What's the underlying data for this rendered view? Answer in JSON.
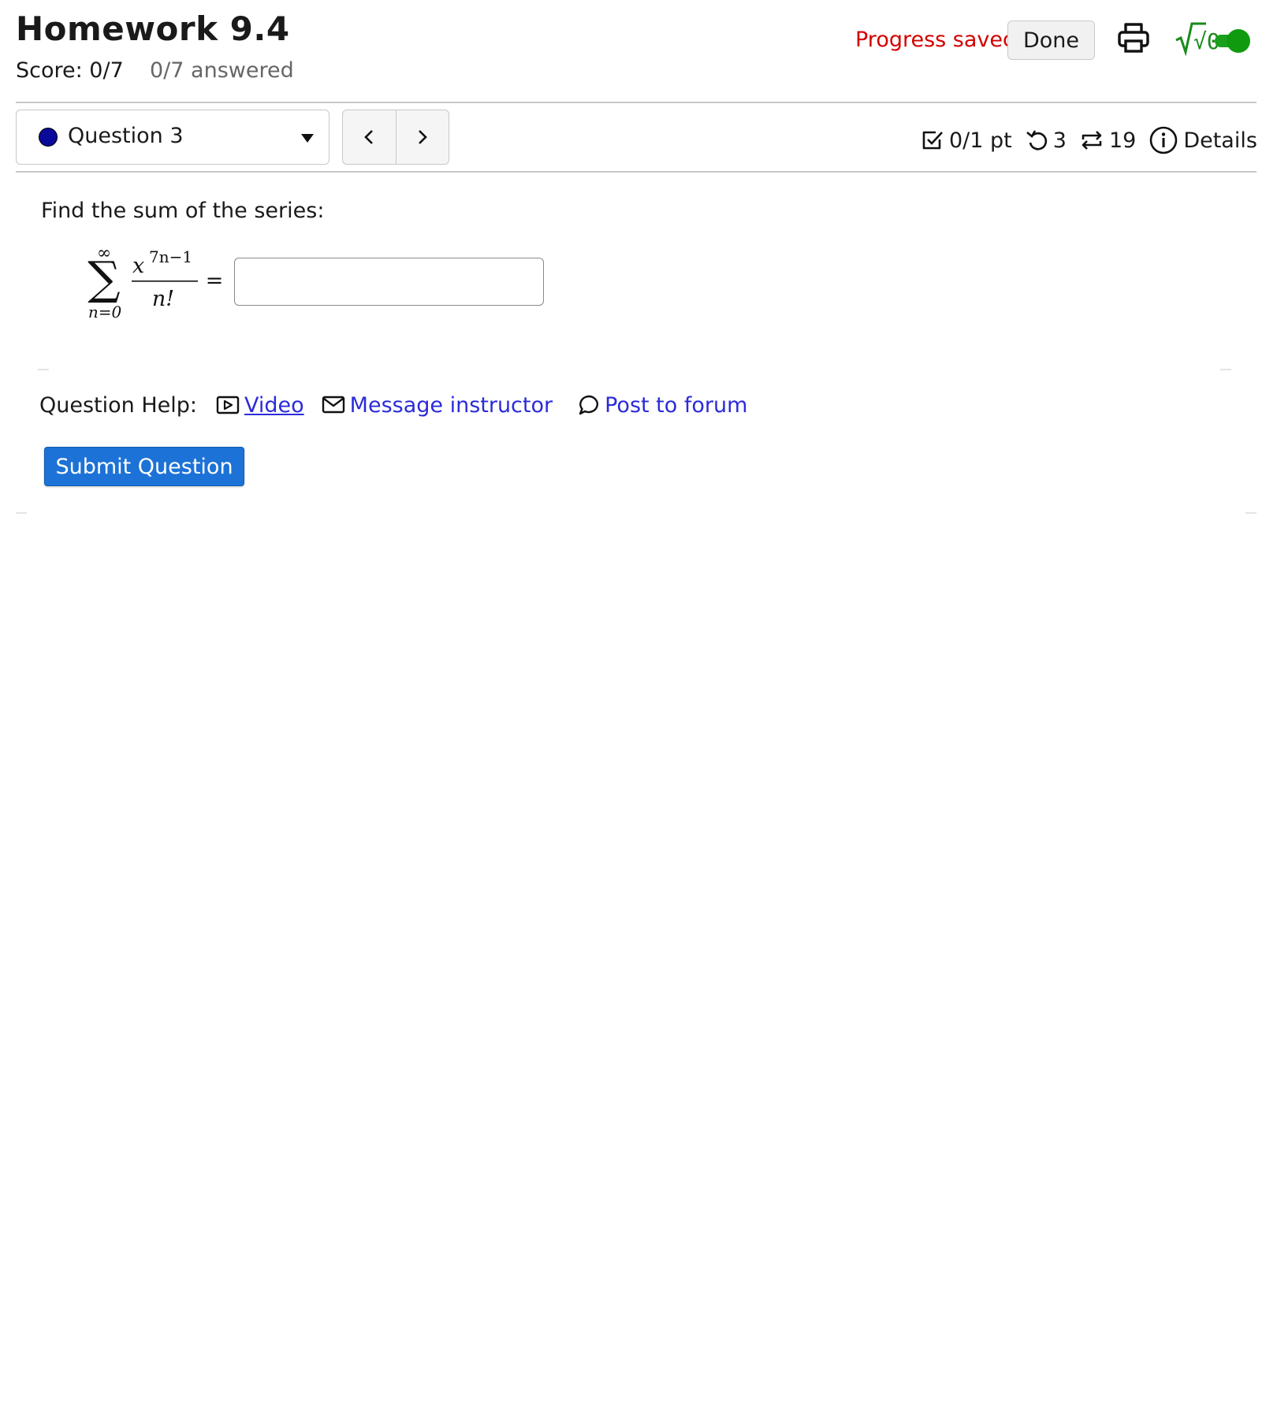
{
  "header": {
    "title": "Homework 9.4",
    "score": "Score: 0/7",
    "answered": "0/7 answered",
    "progress_status": "Progress saved",
    "done_label": "Done",
    "math_toggle_label": "√0",
    "math_toggle_on": true
  },
  "question_nav": {
    "selected_question": "Question 3",
    "status_color": "#0a0a9a"
  },
  "question_meta": {
    "points": "0/1 pt",
    "retries": "3",
    "attempts": "19",
    "details_label": "Details"
  },
  "question": {
    "prompt": "Find the sum of the series:",
    "sum_upper": "∞",
    "sum_lower": "n=0",
    "numerator_base": "x",
    "numerator_exponent": "7n−1",
    "denominator": "n!",
    "equals": "=",
    "answer_value": ""
  },
  "help": {
    "label": "Question Help:",
    "video": "Video",
    "message": "Message instructor",
    "forum": "Post to forum"
  },
  "submit_label": "Submit Question",
  "colors": {
    "progress_saved": "#d40000",
    "link": "#2b2bd9",
    "submit": "#1c72d6",
    "toggle_on": "#1aa01a"
  }
}
